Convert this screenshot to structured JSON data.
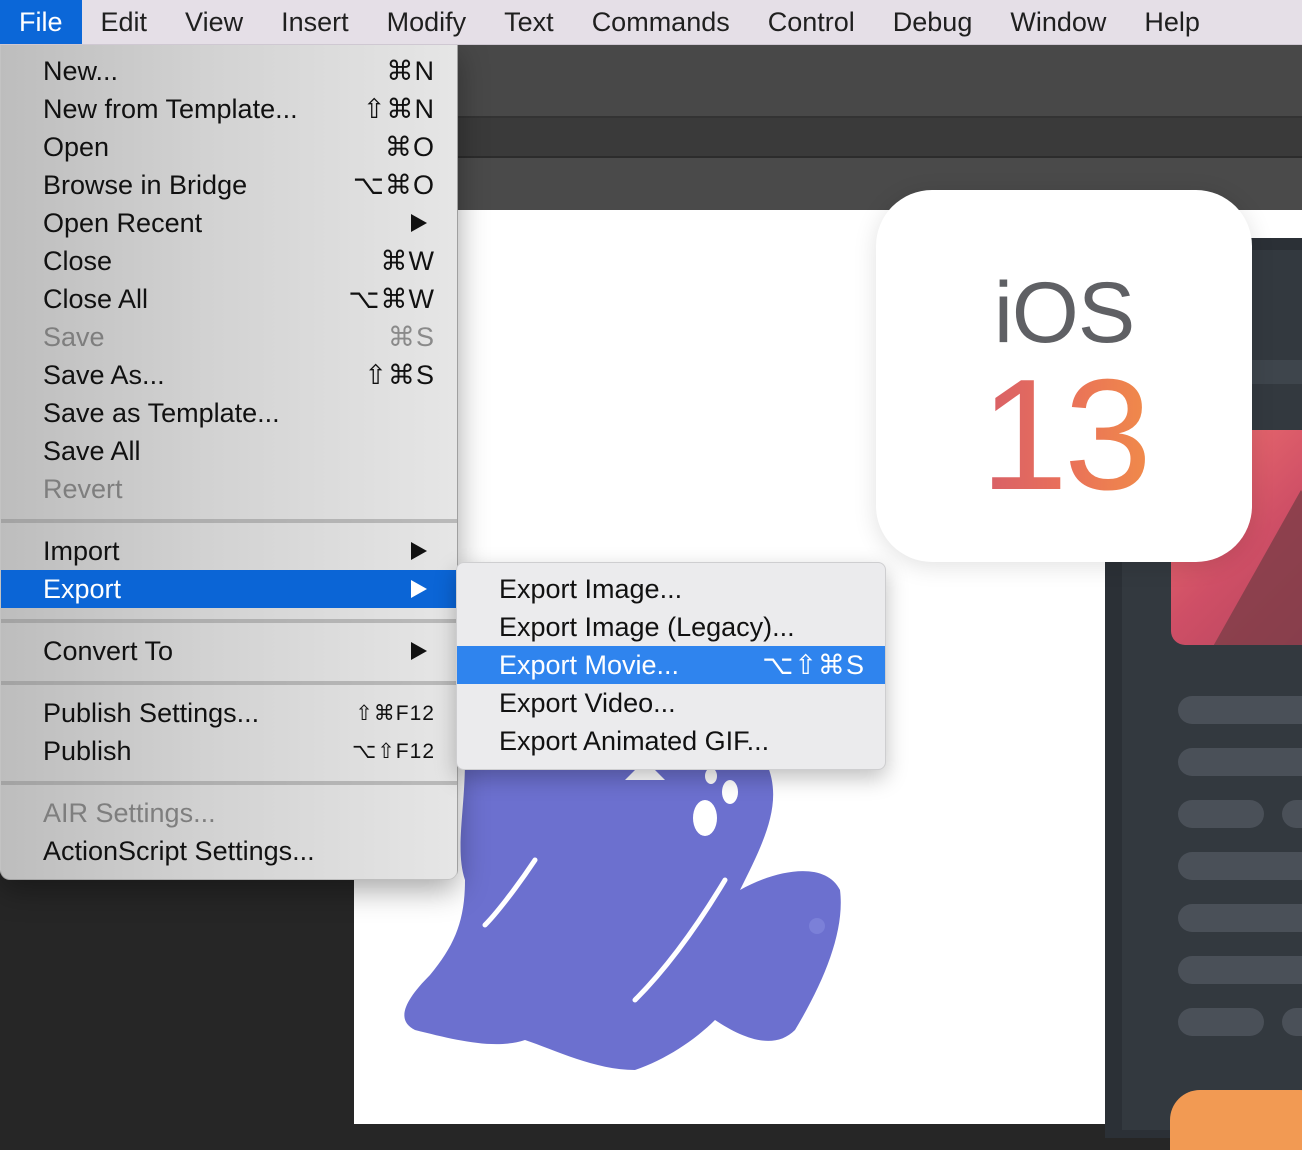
{
  "menubar": {
    "items": [
      {
        "label": "File",
        "active": true
      },
      {
        "label": "Edit"
      },
      {
        "label": "View"
      },
      {
        "label": "Insert"
      },
      {
        "label": "Modify"
      },
      {
        "label": "Text"
      },
      {
        "label": "Commands"
      },
      {
        "label": "Control"
      },
      {
        "label": "Debug"
      },
      {
        "label": "Window"
      },
      {
        "label": "Help"
      }
    ]
  },
  "file_menu": {
    "items": [
      {
        "label": "New...",
        "shortcut": "⌘N"
      },
      {
        "label": "New from Template...",
        "shortcut": "⇧⌘N"
      },
      {
        "label": "Open",
        "shortcut": "⌘O"
      },
      {
        "label": "Browse in Bridge",
        "shortcut": "⌥⌘O"
      },
      {
        "label": "Open Recent",
        "submenu": true
      },
      {
        "label": "Close",
        "shortcut": "⌘W"
      },
      {
        "label": "Close All",
        "shortcut": "⌥⌘W"
      },
      {
        "label": "Save",
        "shortcut": "⌘S",
        "disabled": true
      },
      {
        "label": "Save As...",
        "shortcut": "⇧⌘S"
      },
      {
        "label": "Save as Template..."
      },
      {
        "label": "Save All"
      },
      {
        "label": "Revert",
        "disabled": true
      },
      {
        "label": "Import",
        "submenu": true
      },
      {
        "label": "Export",
        "submenu": true,
        "highlighted": true
      },
      {
        "label": "Convert To",
        "submenu": true
      },
      {
        "label": "Publish Settings...",
        "shortcut": "⇧⌘F12"
      },
      {
        "label": "Publish",
        "shortcut": "⌥⇧F12"
      },
      {
        "label": "AIR Settings...",
        "disabled": true
      },
      {
        "label": "ActionScript Settings..."
      }
    ]
  },
  "export_submenu": {
    "items": [
      {
        "label": "Export Image..."
      },
      {
        "label": "Export Image (Legacy)..."
      },
      {
        "label": "Export Movie...",
        "shortcut": "⌥⇧⌘S",
        "highlighted": true
      },
      {
        "label": "Export Video..."
      },
      {
        "label": "Export Animated GIF..."
      }
    ]
  },
  "canvas": {
    "ios_badge": {
      "word": "iOS",
      "number": "13"
    }
  },
  "colors": {
    "menu_highlight": "#0b65d6",
    "submenu_highlight": "#2f84ee",
    "ghost": "#6c70cf",
    "ios_gradient_start": "#d75f68",
    "ios_gradient_end": "#f08a4a"
  }
}
